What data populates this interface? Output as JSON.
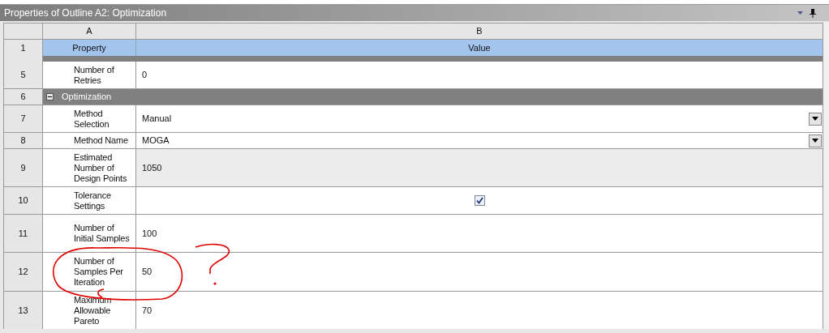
{
  "panel": {
    "title": "Properties of Outline A2: Optimization"
  },
  "table": {
    "columns": [
      "A",
      "B"
    ],
    "header": {
      "number": "1",
      "property": "Property",
      "value": "Value"
    },
    "rows": [
      {
        "number": "5",
        "kind": "text",
        "label": "Number of Retries",
        "value": "0",
        "readonly": false
      },
      {
        "number": "6",
        "kind": "group",
        "label": "Optimization",
        "expanded": true
      },
      {
        "number": "7",
        "kind": "dropdown",
        "label": "Method Selection",
        "value": "Manual"
      },
      {
        "number": "8",
        "kind": "dropdown",
        "label": "Method Name",
        "value": "MOGA"
      },
      {
        "number": "9",
        "kind": "text",
        "label": "Estimated Number of Design Points",
        "value": "1050",
        "readonly": true
      },
      {
        "number": "10",
        "kind": "checkbox",
        "label": "Tolerance Settings",
        "checked": true
      },
      {
        "number": "11",
        "kind": "text",
        "label": "Number of Initial Samples",
        "value": "100",
        "readonly": false
      },
      {
        "number": "12",
        "kind": "text",
        "label": "Number of Samples Per Iteration",
        "value": "50",
        "readonly": false
      },
      {
        "number": "13",
        "kind": "text",
        "label": "Maximum Allowable Pareto",
        "value": "70",
        "readonly": false
      }
    ]
  }
}
